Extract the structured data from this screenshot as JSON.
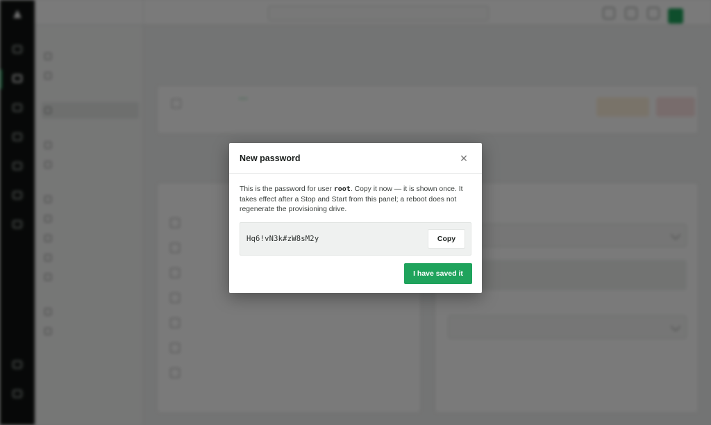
{
  "app": {
    "project_name": "",
    "search_placeholder": "",
    "rail_items": [
      "",
      "",
      "",
      "",
      "",
      "",
      ""
    ],
    "rail_bottom_items": [
      "",
      ""
    ],
    "subnav_sections": [
      "",
      "",
      "",
      ""
    ],
    "subnav_items": [
      "",
      "",
      "",
      "",
      "",
      "",
      "",
      "",
      "",
      "",
      "",
      ""
    ],
    "breadcrumbs": [
      "",
      "",
      "",
      ""
    ],
    "back_link": "",
    "server": {
      "name": "",
      "status": "",
      "ip": "",
      "meta": [
        "",
        "",
        ""
      ],
      "console_label": "",
      "reboot_label": "",
      "stop_label": ""
    },
    "tabs": [
      "",
      "",
      "",
      "",
      "",
      "",
      "",
      ""
    ],
    "spec_title": "",
    "spec_rows": [
      {
        "label": "",
        "value": ""
      },
      {
        "label": "",
        "value": ""
      },
      {
        "label": "",
        "value": ""
      },
      {
        "label": "",
        "value": ""
      },
      {
        "label": "",
        "value": ""
      },
      {
        "label": "",
        "value": ""
      },
      {
        "label": "",
        "value": ""
      }
    ],
    "network": {
      "field1": "",
      "note": "",
      "label2": "",
      "field2": ""
    },
    "footer": ""
  },
  "modal": {
    "title": "New password",
    "close_icon": "close-icon",
    "body_part1": "This is the password for user ",
    "user": "root",
    "body_part2": ". Copy it now — it is shown once. It takes effect after a Stop and Start from this panel; a reboot does not regenerate the provisioning drive.",
    "password": "Hq6!vN3k#zW8sM2y",
    "copy_label": "Copy",
    "confirm_label": "I have saved it"
  },
  "colors": {
    "accent": "#1fa35c",
    "overlay": "rgba(0,0,0,0.52)",
    "rail_bg": "#0f1211"
  }
}
